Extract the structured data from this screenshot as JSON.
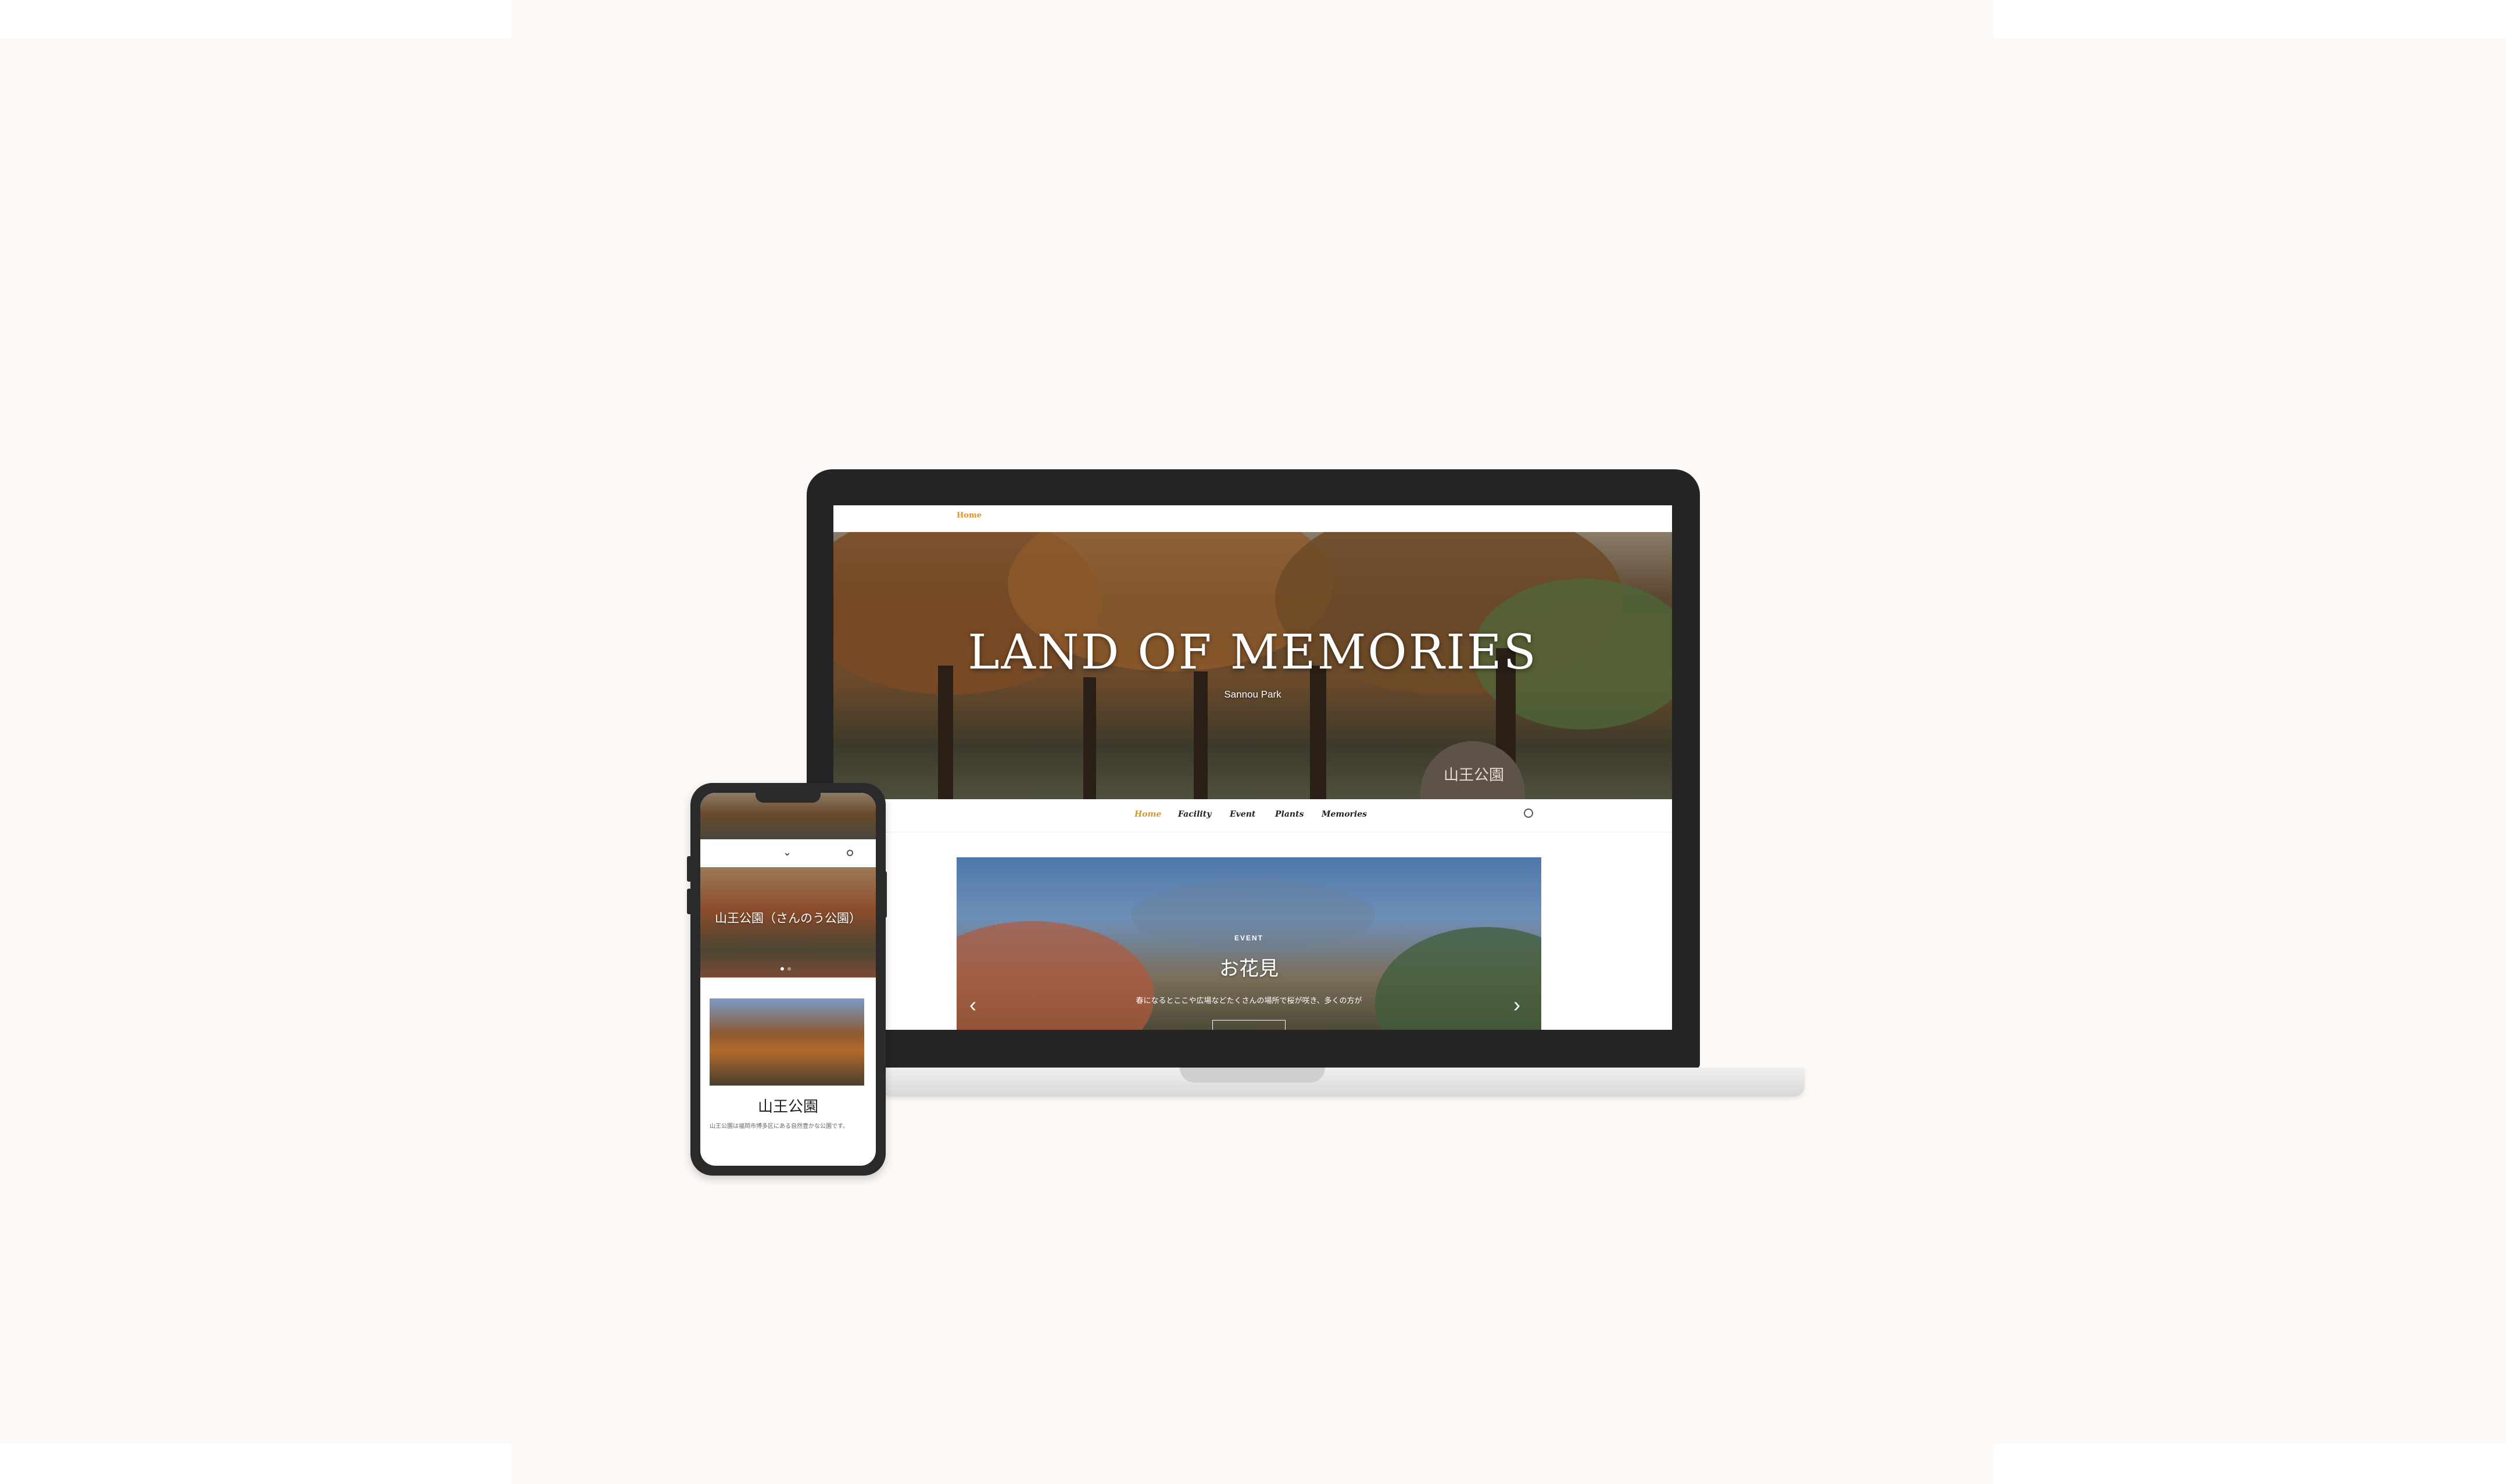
{
  "topbar": {
    "home_label": "Home"
  },
  "hero": {
    "title": "LAND OF MEMORIES",
    "subtitle": "Sannou Park",
    "sign_text": "山王公園"
  },
  "nav": {
    "items": [
      "Home",
      "Facility",
      "Event",
      "Plants",
      "Memories"
    ],
    "active": "Home",
    "theme_icon": "moon-icon"
  },
  "slider": {
    "tag": "EVENT",
    "title": "お花見",
    "description": "春になるとここや広場などたくさんの場所で桜が咲き、多くの方が",
    "prev_icon": "chevron-left-icon",
    "next_icon": "chevron-right-icon"
  },
  "phone": {
    "menu_icon": "chevron-down-icon",
    "theme_icon": "moon-icon",
    "slide_title": "山王公園（さんのう公園）",
    "card_title": "山王公園",
    "card_text": "山王公園は福岡市博多区にある自然豊かな公園です。"
  },
  "colors": {
    "accent": "#d9952e",
    "device_frame": "#242424",
    "background": "#fcf8f6"
  }
}
